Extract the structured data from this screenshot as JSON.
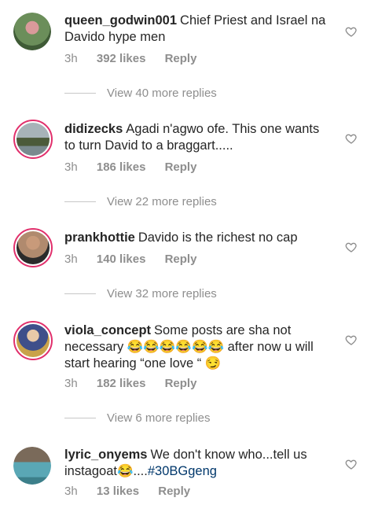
{
  "comments": [
    {
      "username": "queen_godwin001",
      "text": "Chief Priest and Israel na Davido hype men",
      "tag": "",
      "time": "3h",
      "likes": "392 likes",
      "reply": "Reply",
      "view_replies": "View 40 more replies",
      "story_ring": false,
      "avatar_color": "#6b8e5a"
    },
    {
      "username": "didizecks",
      "text": "Agadi n'agwo ofe. This one wants to turn David to a braggart.....",
      "tag": "",
      "time": "3h",
      "likes": "186 likes",
      "reply": "Reply",
      "view_replies": "View 22 more replies",
      "story_ring": true,
      "avatar_color": "#7a8a8f"
    },
    {
      "username": "prankhottie",
      "text": "Davido is the richest no cap",
      "tag": "",
      "time": "3h",
      "likes": "140 likes",
      "reply": "Reply",
      "view_replies": "View 32 more replies",
      "story_ring": true,
      "avatar_color": "#b08a6e"
    },
    {
      "username": "viola_concept",
      "text": "Some posts are sha not necessary 😂😂😂😂😂😂 after now u will start hearing “one love “ 😏",
      "tag": "",
      "time": "3h",
      "likes": "182 likes",
      "reply": "Reply",
      "view_replies": "View 6 more replies",
      "story_ring": true,
      "avatar_color": "#3f4f8a"
    },
    {
      "username": "lyric_onyems",
      "text": "We don't know who...tell us instagoat😂....",
      "tag": "#30BGgeng",
      "time": "3h",
      "likes": "13 likes",
      "reply": "Reply",
      "view_replies": "",
      "story_ring": false,
      "avatar_color": "#5aa7b5"
    }
  ],
  "icons": {
    "like": "heart-outline-icon"
  }
}
